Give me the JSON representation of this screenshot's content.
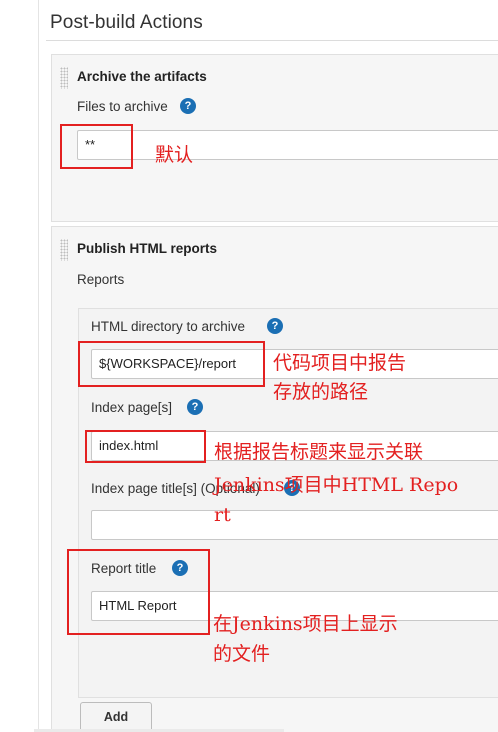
{
  "page": {
    "title": "Post-build Actions"
  },
  "archive": {
    "title": "Archive the artifacts",
    "files_label": "Files to archive",
    "files_value": "**"
  },
  "publish": {
    "title": "Publish HTML reports",
    "reports_label": "Reports",
    "dir_label": "HTML directory to archive",
    "dir_value": "${WORKSPACE}/report",
    "index_label": "Index page[s]",
    "index_value": "index.html",
    "index_title_label": "Index page title[s] (Optional)",
    "index_title_value": "",
    "report_title_label": "Report title",
    "report_title_value": "HTML Report",
    "add_label": "Add"
  },
  "help": {
    "glyph": "?"
  },
  "annotations": {
    "default": "默认",
    "dir_line1": "代码项目中报告",
    "dir_line2": "存放的路径",
    "index_line1": "根据报告标题来显示关联",
    "index_line2": "Jenkins项目中HTML Repo",
    "index_line3": "rt",
    "title_line1": "在Jenkins项目上显示",
    "title_line2": "的文件"
  },
  "colors": {
    "help": "#1b6fb4",
    "annotation": "#e32020"
  }
}
